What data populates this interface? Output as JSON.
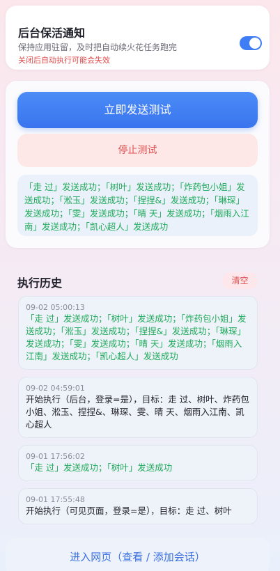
{
  "keepalive": {
    "title": "后台保活通知",
    "desc": "保持应用驻留，及时把自动续火花任务跑完",
    "warning": "关闭后自动执行可能会失效",
    "enabled": true
  },
  "actions": {
    "send_test": "立即发送测试",
    "stop_test": "停止测试"
  },
  "status_text": "「走 过」发送成功；「树叶」发送成功；「炸药包小姐」发送成功；「淞玉」发送成功；「捏捏&」发送成功；「琳琛」发送成功；「雯」发送成功；「晴 天」发送成功；「烟雨入江南」发送成功；「凯心超人」发送成功",
  "history": {
    "title": "执行历史",
    "clear_label": "清空",
    "items": [
      {
        "time": "09-02 05:00:13",
        "text": "「走 过」发送成功；「树叶」发送成功；「炸药包小姐」发送成功；「淞玉」发送成功；「捏捏&」发送成功；「琳琛」发送成功；「雯」发送成功；「晴 天」发送成功；「烟雨入江南」发送成功；「凯心超人」发送成功",
        "tone": "green"
      },
      {
        "time": "09-02 04:59:01",
        "text": "开始执行（后台，登录=是），目标：走 过、树叶、炸药包小姐、淞玉、捏捏&、琳琛、雯、晴 天、烟雨入江南、凯心超人",
        "tone": "dark"
      },
      {
        "time": "09-01 17:56:02",
        "text": "「走 过」发送成功；「树叶」发送成功",
        "tone": "green"
      },
      {
        "time": "09-01 17:55:48",
        "text": "开始执行（可见页面，登录=是），目标：走 过、树叶",
        "tone": "dark"
      }
    ]
  },
  "web_button": "进入网页（查看 / 添加会话）",
  "colors": {
    "accent": "#3f7df5",
    "success": "#1faa5a",
    "danger": "#e0504f"
  }
}
